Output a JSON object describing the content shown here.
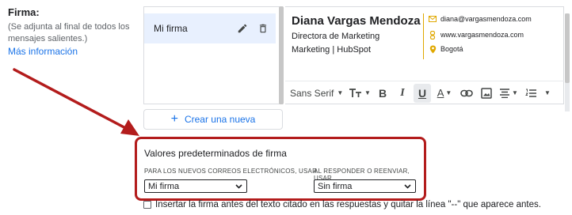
{
  "settings": {
    "label": "Firma:",
    "description": "(Se adjunta al final de todos los mensajes salientes.)",
    "more_info": "Más información"
  },
  "signature_list": {
    "items": [
      {
        "label": "Mi firma"
      }
    ],
    "create_new": "Crear una nueva"
  },
  "signature": {
    "name": "Diana Vargas Mendoza",
    "role": "Directora de Marketing",
    "company": "Marketing | HubSpot",
    "email": "diana@vargasmendoza.com",
    "website": "www.vargasmendoza.com",
    "location": "Bogotá",
    "accent_color": "#e0a800"
  },
  "toolbar": {
    "font": "Sans Serif",
    "buttons": [
      "text-size-icon",
      "bold-icon",
      "italic-icon",
      "underline-icon",
      "text-color-icon",
      "link-icon",
      "image-icon",
      "align-icon",
      "numbered-list-icon",
      "more-icon"
    ]
  },
  "defaults": {
    "title": "Valores predeterminados de firma",
    "new_mail_label": "PARA LOS NUEVOS CORREOS ELECTRÓNICOS, USAR",
    "new_mail_value": "Mi firma",
    "reply_label": "AL RESPONDER O REENVIAR, USAR",
    "reply_value": "Sin firma",
    "highlight_color": "#b31c1c"
  },
  "insert_option": {
    "label": "Insertar la firma antes del texto citado en las respuestas y quitar la línea \"--\" que aparece antes.",
    "checked": false
  },
  "colors": {
    "link": "#1a73e8",
    "selected_bg": "#e8f0fe",
    "annotation": "#b31c1c"
  }
}
